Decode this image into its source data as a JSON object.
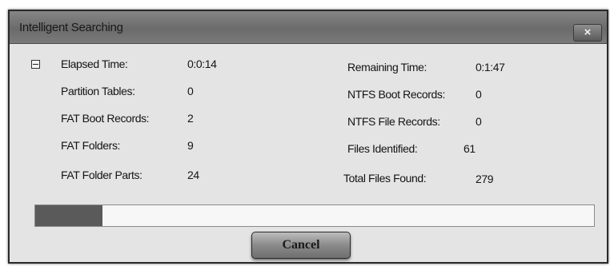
{
  "window": {
    "title": "Intelligent Searching",
    "close_glyph": "×"
  },
  "stats_left": [
    {
      "label": "Elapsed Time:",
      "value": "0:0:14"
    },
    {
      "label": "Partition Tables:",
      "value": "0"
    },
    {
      "label": "FAT Boot Records:",
      "value": "2"
    },
    {
      "label": "FAT Folders:",
      "value": "9"
    },
    {
      "label": "FAT Folder Parts:",
      "value": "24"
    }
  ],
  "stats_right": [
    {
      "label": "Remaining Time:",
      "value": "0:1:47"
    },
    {
      "label": "NTFS Boot Records:",
      "value": "0"
    },
    {
      "label": "NTFS File Records:",
      "value": "0"
    },
    {
      "label": "Files Identified:",
      "value": "61"
    },
    {
      "label": "Total Files Found:",
      "value": "279"
    }
  ],
  "progress": {
    "fraction": 0.12
  },
  "buttons": {
    "cancel_label": "Cancel"
  },
  "icons": {
    "collapse": "collapse-minus-icon",
    "close": "close-icon"
  }
}
